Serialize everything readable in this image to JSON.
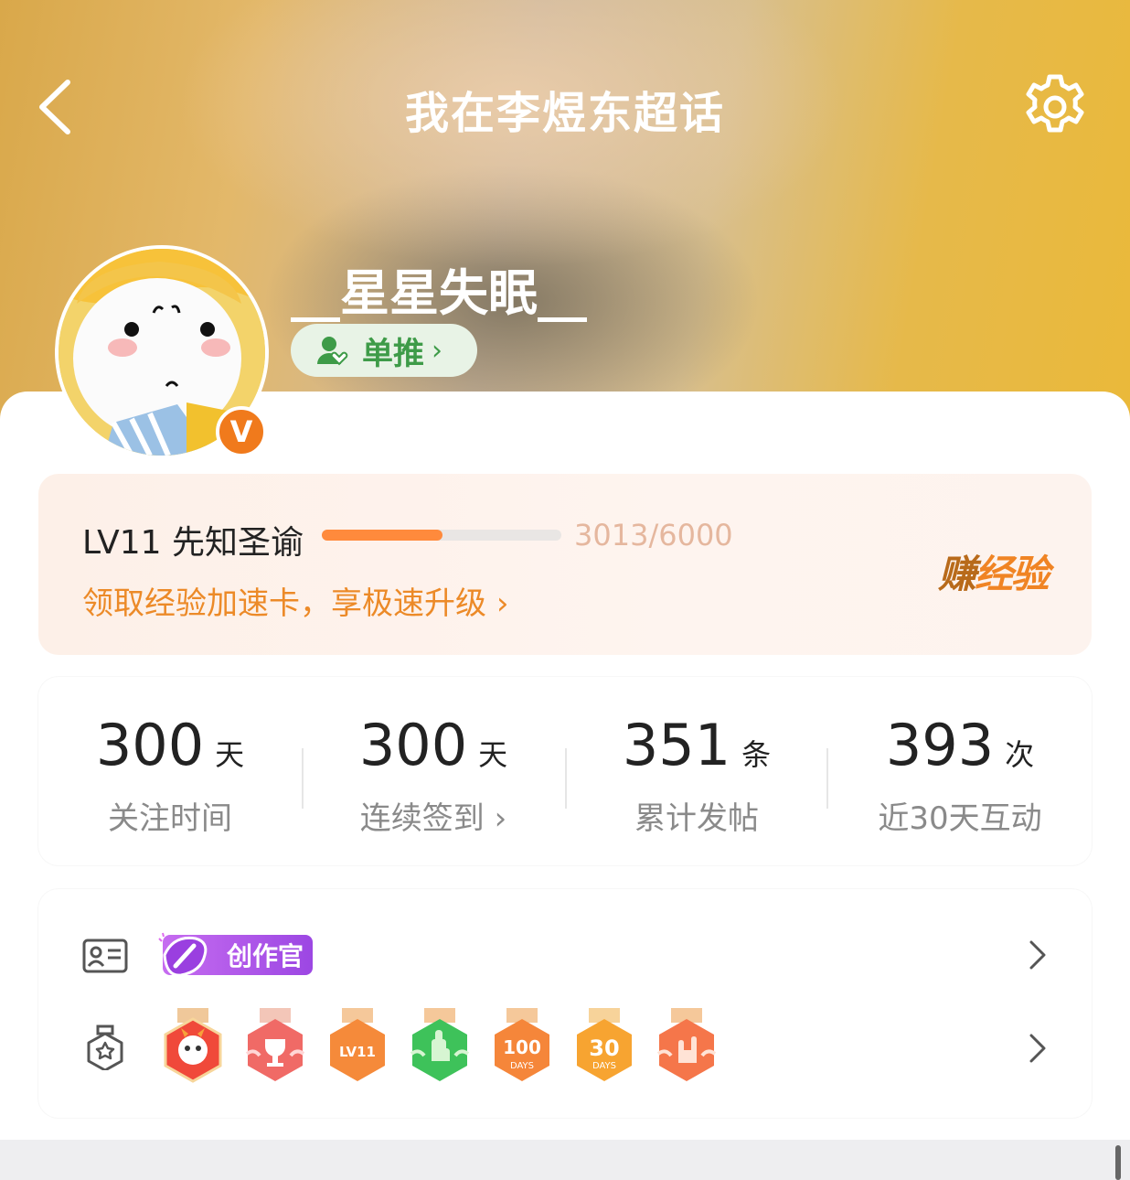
{
  "header": {
    "title": "我在李煜东超话",
    "back_icon": "back-arrow-icon",
    "settings_icon": "gear-icon"
  },
  "profile": {
    "username": "__星星失眠__",
    "tag_label": "单推",
    "verified_badge": "V"
  },
  "level": {
    "name": "LV11 先知圣谕",
    "progress_text": "3013/6000",
    "progress_fraction": 0.502,
    "promo_text": "领取经验加速卡，享极速升级",
    "earn_prefix": "赚",
    "earn_suffix": "经验",
    "colors": {
      "accent": "#ff8a3c",
      "promo": "#ec8a28"
    }
  },
  "stats": [
    {
      "value": "300",
      "unit": "天",
      "label": "关注时间"
    },
    {
      "value": "300",
      "unit": "天",
      "label": "连续签到"
    },
    {
      "value": "351",
      "unit": "条",
      "label": "累计发帖"
    },
    {
      "value": "393",
      "unit": "次",
      "label": "近30天互动"
    }
  ],
  "badges": {
    "creator_label": "创作官",
    "medal_icons": [
      "mascot-medal-icon",
      "trophy-medal-icon",
      "lv11-medal-icon",
      "hand-medal-icon",
      "100-days-medal-icon",
      "30-days-medal-icon",
      "rock-hand-medal-icon"
    ],
    "medal_texts": {
      "lv": "LV11",
      "d100": "100",
      "d30": "30",
      "days": "DAYS"
    }
  }
}
